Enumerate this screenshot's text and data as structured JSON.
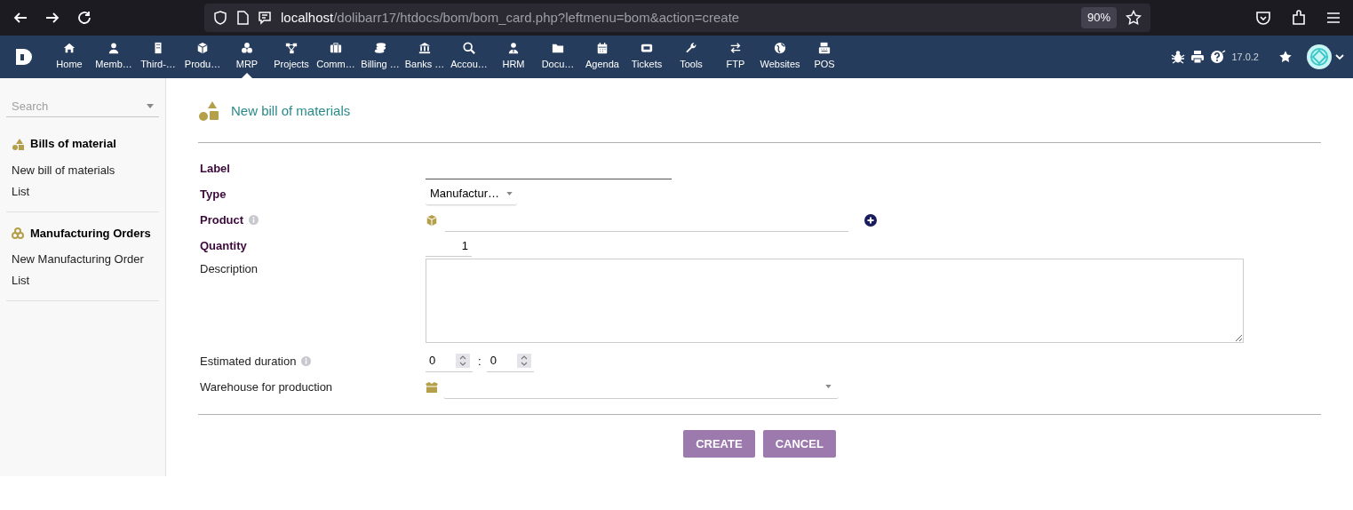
{
  "browser": {
    "url_host": "localhost",
    "url_path": "/dolibarr17/htdocs/bom/bom_card.php?leftmenu=bom&action=create",
    "zoom": "90%"
  },
  "topnav": {
    "items": [
      {
        "label": "Home",
        "selected": false
      },
      {
        "label": "Memb…",
        "selected": false
      },
      {
        "label": "Third-…",
        "selected": false
      },
      {
        "label": "Produ…",
        "selected": false
      },
      {
        "label": "MRP",
        "selected": true
      },
      {
        "label": "Projects",
        "selected": false
      },
      {
        "label": "Comm…",
        "selected": false
      },
      {
        "label": "Billing …",
        "selected": false
      },
      {
        "label": "Banks …",
        "selected": false
      },
      {
        "label": "Accou…",
        "selected": false
      },
      {
        "label": "HRM",
        "selected": false
      },
      {
        "label": "Docu…",
        "selected": false
      },
      {
        "label": "Agenda",
        "selected": false
      },
      {
        "label": "Tickets",
        "selected": false
      },
      {
        "label": "Tools",
        "selected": false
      },
      {
        "label": "FTP",
        "selected": false
      },
      {
        "label": "Websites",
        "selected": false
      },
      {
        "label": "POS",
        "selected": false
      }
    ],
    "version": "17.0.2"
  },
  "sidebar": {
    "search_placeholder": "Search",
    "sections": [
      {
        "title": "Bills of material",
        "items": [
          "New bill of materials",
          "List"
        ]
      },
      {
        "title": "Manufacturing Orders",
        "items": [
          "New Manufacturing Order",
          "List"
        ]
      }
    ]
  },
  "page": {
    "title": "New bill of materials",
    "fields": [
      {
        "kind": "text",
        "label": "Label",
        "required": true
      },
      {
        "kind": "select",
        "label": "Type",
        "required": true,
        "value": "Manufactur…"
      },
      {
        "kind": "product",
        "label": "Product",
        "required": true,
        "info": true
      },
      {
        "kind": "number",
        "label": "Quantity",
        "required": true,
        "value": "1"
      },
      {
        "kind": "textarea",
        "label": "Description",
        "required": false
      },
      {
        "kind": "duration",
        "label": "Estimated duration",
        "required": false,
        "info": true,
        "hours": "0",
        "separator": ":",
        "minutes": "0"
      },
      {
        "kind": "warehouse",
        "label": "Warehouse for production",
        "required": false
      }
    ],
    "buttons": [
      "CREATE",
      "CANCEL"
    ]
  }
}
